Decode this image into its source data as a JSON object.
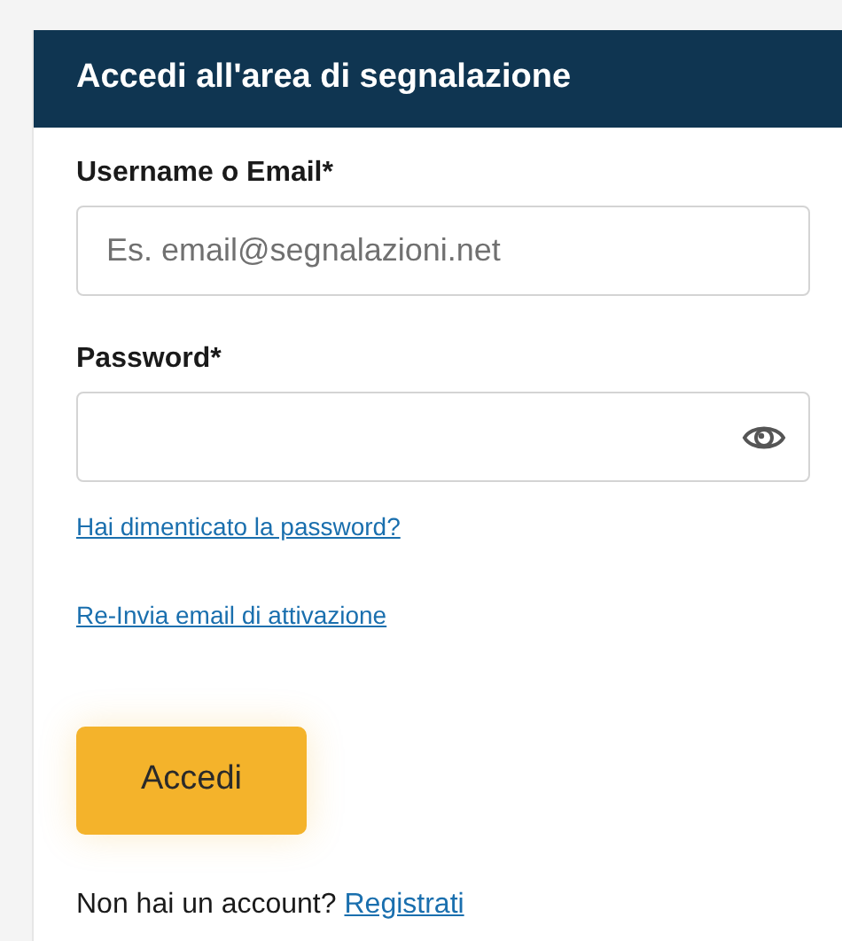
{
  "header": {
    "title": "Accedi all'area di segnalazione"
  },
  "fields": [
    {
      "label": "Username o Email*",
      "placeholder": "Es. email@segnalazioni.net",
      "kind": "text"
    },
    {
      "label": "Password*",
      "kind": "password"
    }
  ],
  "links": [
    "Hai dimenticato la password?",
    "Re-Invia email di attivazione"
  ],
  "submit": "Accedi",
  "footer": {
    "text": "Non hai un account?",
    "link": "Registrati"
  }
}
